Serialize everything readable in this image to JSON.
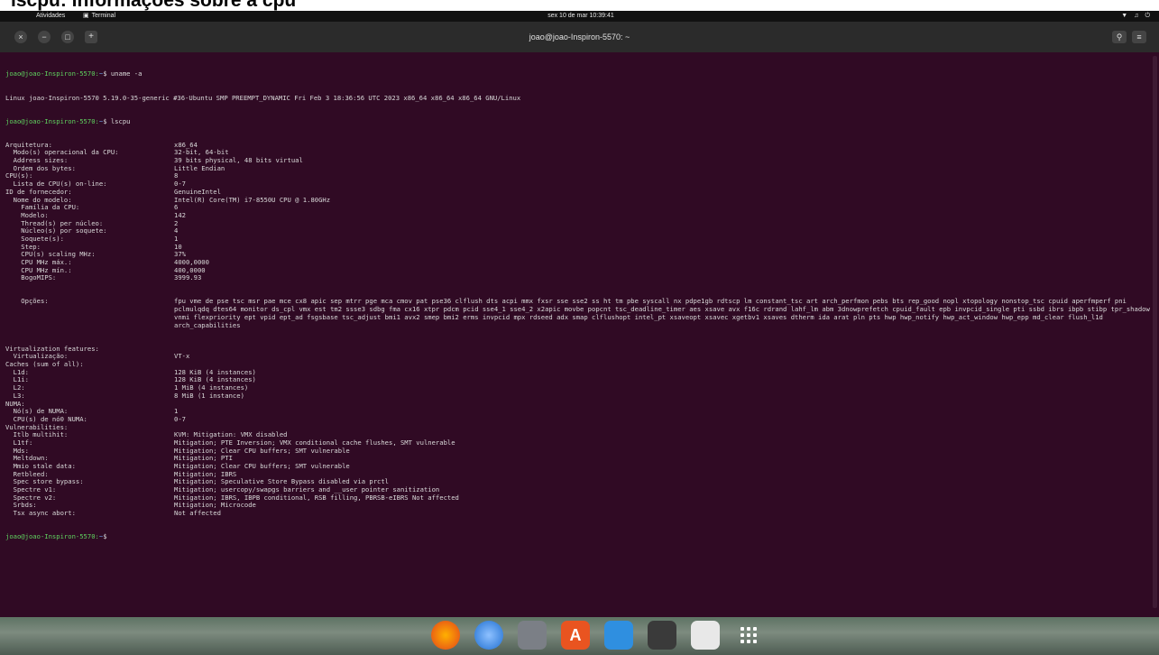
{
  "caption": "lscpu: informações sobre a cpu",
  "topbar": {
    "activities": "Atividades",
    "app": "Terminal",
    "clock": "sex 10 de mar  10:39:41"
  },
  "window": {
    "title": "joao@joao-Inspiron-5570: ~"
  },
  "terminal": {
    "prompt": "joao@joao-Inspiron-5570:",
    "path": "~",
    "cmd1": "$ uname -a",
    "uname_output": "Linux joao-Inspiron-5570 5.19.0-35-generic #36-Ubuntu SMP PREEMPT_DYNAMIC Fri Feb 3 18:36:56 UTC 2023 x86_64 x86_64 x86_64 GNU/Linux",
    "cmd2": "$ lscpu",
    "lines": [
      {
        "k": "Arquitetura:",
        "v": "x86_64"
      },
      {
        "k": "  Modo(s) operacional da CPU:",
        "v": "32-bit, 64-bit"
      },
      {
        "k": "  Address sizes:",
        "v": "39 bits physical, 48 bits virtual"
      },
      {
        "k": "  Ordem dos bytes:",
        "v": "Little Endian"
      },
      {
        "k": "CPU(s):",
        "v": "8"
      },
      {
        "k": "  Lista de CPU(s) on-line:",
        "v": "0-7"
      },
      {
        "k": "ID de fornecedor:",
        "v": "GenuineIntel"
      },
      {
        "k": "  Nome do modelo:",
        "v": "Intel(R) Core(TM) i7-8550U CPU @ 1.80GHz"
      },
      {
        "k": "    Família da CPU:",
        "v": "6"
      },
      {
        "k": "    Modelo:",
        "v": "142"
      },
      {
        "k": "    Thread(s) per núcleo:",
        "v": "2"
      },
      {
        "k": "    Núcleo(s) por soquete:",
        "v": "4"
      },
      {
        "k": "    Soquete(s):",
        "v": "1"
      },
      {
        "k": "    Step:",
        "v": "10"
      },
      {
        "k": "    CPU(s) scaling MHz:",
        "v": "37%"
      },
      {
        "k": "    CPU MHz máx.:",
        "v": "4000,0000"
      },
      {
        "k": "    CPU MHz mín.:",
        "v": "400,0000"
      },
      {
        "k": "    BogoMIPS:",
        "v": "3999.93"
      }
    ],
    "flags_key": "    Opções:",
    "flags_value": "fpu vme de pse tsc msr pae mce cx8 apic sep mtrr pge mca cmov pat pse36 clflush dts acpi mmx fxsr sse sse2 ss ht tm pbe syscall nx pdpe1gb rdtscp lm constant_tsc art arch_perfmon pebs bts rep_good nopl xtopology nonstop_tsc cpuid aperfmperf pni pclmulqdq dtes64 monitor ds_cpl vmx est tm2 ssse3 sdbg fma cx16 xtpr pdcm pcid sse4_1 sse4_2 x2apic movbe popcnt tsc_deadline_timer aes xsave avx f16c rdrand lahf_lm abm 3dnowprefetch cpuid_fault epb invpcid_single pti ssbd ibrs ibpb stibp tpr_shadow vnmi flexpriority ept vpid ept_ad fsgsbase tsc_adjust bmi1 avx2 smep bmi2 erms invpcid mpx rdseed adx smap clflushopt intel_pt xsaveopt xsavec xgetbv1 xsaves dtherm ida arat pln pts hwp hwp_notify hwp_act_window hwp_epp md_clear flush_l1d arch_capabilities",
    "lines2": [
      {
        "k": "Virtualization features:",
        "v": ""
      },
      {
        "k": "  Virtualização:",
        "v": "VT-x"
      },
      {
        "k": "Caches (sum of all):",
        "v": ""
      },
      {
        "k": "  L1d:",
        "v": "128 KiB (4 instances)"
      },
      {
        "k": "  L1i:",
        "v": "128 KiB (4 instances)"
      },
      {
        "k": "  L2:",
        "v": "1 MiB (4 instances)"
      },
      {
        "k": "  L3:",
        "v": "8 MiB (1 instance)"
      },
      {
        "k": "NUMA:",
        "v": ""
      },
      {
        "k": "  Nó(s) de NUMA:",
        "v": "1"
      },
      {
        "k": "  CPU(s) de nó0 NUMA:",
        "v": "0-7"
      },
      {
        "k": "Vulnerabilities:",
        "v": ""
      },
      {
        "k": "  Itlb multihit:",
        "v": "KVM: Mitigation: VMX disabled"
      },
      {
        "k": "  L1tf:",
        "v": "Mitigation; PTE Inversion; VMX conditional cache flushes, SMT vulnerable"
      },
      {
        "k": "  Mds:",
        "v": "Mitigation; Clear CPU buffers; SMT vulnerable"
      },
      {
        "k": "  Meltdown:",
        "v": "Mitigation; PTI"
      },
      {
        "k": "  Mmio stale data:",
        "v": "Mitigation; Clear CPU buffers; SMT vulnerable"
      },
      {
        "k": "  Retbleed:",
        "v": "Mitigation; IBRS"
      },
      {
        "k": "  Spec store bypass:",
        "v": "Mitigation; Speculative Store Bypass disabled via prctl"
      },
      {
        "k": "  Spectre v1:",
        "v": "Mitigation; usercopy/swapgs barriers and __user pointer sanitization"
      },
      {
        "k": "  Spectre v2:",
        "v": "Mitigation; IBRS, IBPB conditional, RSB filling, PBRSB-eIBRS Not affected"
      },
      {
        "k": "  Srbds:",
        "v": "Mitigation; Microcode"
      },
      {
        "k": "  Tsx async abort:",
        "v": "Not affected"
      }
    ],
    "cmd3": "$"
  },
  "dock": {
    "apps": [
      "firefox-icon",
      "thunderbird-icon",
      "files-icon",
      "software-icon",
      "writer-icon",
      "terminal-icon",
      "trash-icon",
      "show-apps-icon"
    ]
  }
}
